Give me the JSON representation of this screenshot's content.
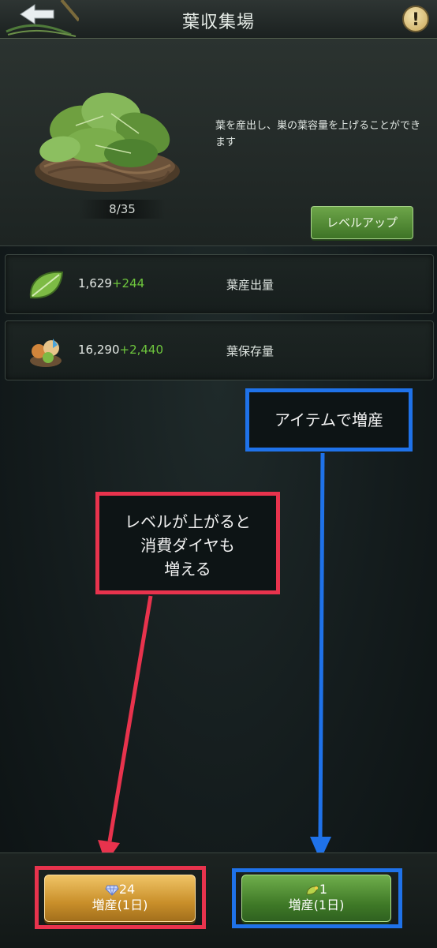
{
  "header": {
    "title": "葉収集場"
  },
  "hero": {
    "level": "8/35",
    "description": "葉を産出し、巣の葉容量を上げることができます",
    "levelup_label": "レベルアップ"
  },
  "stats": [
    {
      "value": "1,629",
      "bonus": "+244",
      "label": "葉産出量",
      "icon": "leaf-icon"
    },
    {
      "value": "16,290",
      "bonus": "+2,440",
      "label": "葉保存量",
      "icon": "storage-icon"
    }
  ],
  "annotations": {
    "blue": "アイテムで増産",
    "red_lines": [
      "レベルが上がると",
      "消費ダイヤも",
      "増える"
    ]
  },
  "buttons": {
    "diamond": {
      "cost": "24",
      "label": "増産(1日)",
      "icon": "diamond-icon"
    },
    "item": {
      "cost": "1",
      "label": "増産(1日)",
      "icon": "leaf-item-icon"
    }
  },
  "colors": {
    "accent_green": "#6ec63d",
    "annotation_blue": "#1f72e9",
    "annotation_red": "#e8334d"
  }
}
